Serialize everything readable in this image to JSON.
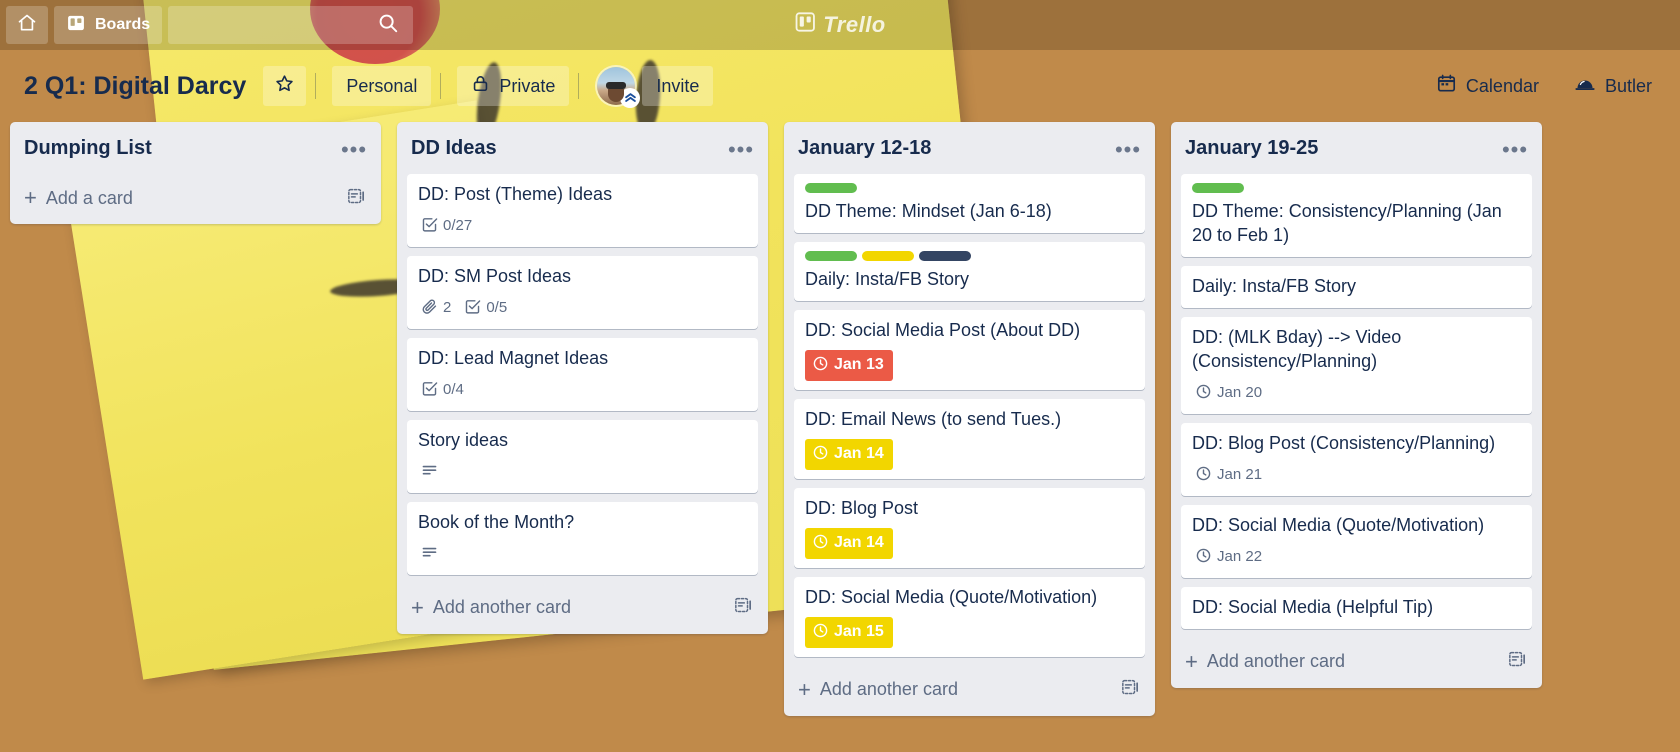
{
  "top_nav": {
    "home_icon": "home-icon",
    "boards_label": "Boards",
    "boards_icon": "board-icon",
    "search_placeholder": "",
    "search_value": "",
    "search_icon": "search-icon",
    "logo_text": "Trello",
    "logo_icon": "trello-logo-icon"
  },
  "board_header": {
    "title": "2 Q1: Digital Darcy",
    "star_icon": "star-icon",
    "visibility_team": "Personal",
    "visibility": "Private",
    "lock_icon": "lock-icon",
    "avatar_name": "avatar",
    "avatar_badge_icon": "premium-chevrons-icon",
    "invite_label": "Invite",
    "calendar_label": "Calendar",
    "calendar_icon": "calendar-icon",
    "butler_label": "Butler",
    "butler_icon": "butler-bell-icon"
  },
  "colors": {
    "label_green": "#61bd4f",
    "label_yellow": "#f2d600",
    "label_navy": "#344563",
    "due_overdue": "#eb5a46",
    "due_soon": "#f2d600",
    "list_bg": "#ebecf0",
    "card_bg": "#ffffff",
    "text": "#172b4d",
    "muted_text": "#5e6c84"
  },
  "add_card_label": "Add a card",
  "add_another_card_label": "Add another card",
  "lists": [
    {
      "title": "Dumping List",
      "menu_icon": "list-menu-icon",
      "add_label": "Add a card",
      "template_icon": "card-template-icon",
      "cards": []
    },
    {
      "title": "DD Ideas",
      "menu_icon": "list-menu-icon",
      "add_label": "Add another card",
      "template_icon": "card-template-icon",
      "cards": [
        {
          "title": "DD: Post (Theme) Ideas",
          "labels": [],
          "badges": [
            {
              "type": "checklist",
              "icon": "checklist-icon",
              "text": "0/27"
            }
          ]
        },
        {
          "title": "DD: SM Post Ideas",
          "labels": [],
          "badges": [
            {
              "type": "attachment",
              "icon": "attachment-icon",
              "text": "2"
            },
            {
              "type": "checklist",
              "icon": "checklist-icon",
              "text": "0/5"
            }
          ]
        },
        {
          "title": "DD: Lead Magnet Ideas",
          "labels": [],
          "badges": [
            {
              "type": "checklist",
              "icon": "checklist-icon",
              "text": "0/4"
            }
          ]
        },
        {
          "title": "Story ideas",
          "labels": [],
          "badges": [
            {
              "type": "description",
              "icon": "description-icon",
              "text": ""
            }
          ]
        },
        {
          "title": "Book of the Month?",
          "labels": [],
          "badges": [
            {
              "type": "description",
              "icon": "description-icon",
              "text": ""
            }
          ]
        }
      ]
    },
    {
      "title": "January 12-18",
      "menu_icon": "list-menu-icon",
      "add_label": "Add another card",
      "template_icon": "card-template-icon",
      "cards": [
        {
          "title": "DD Theme: Mindset (Jan 6-18)",
          "labels": [
            "#61bd4f"
          ],
          "badges": []
        },
        {
          "title": "Daily: Insta/FB Story",
          "labels": [
            "#61bd4f",
            "#f2d600",
            "#344563"
          ],
          "badges": []
        },
        {
          "title": "DD: Social Media Post (About DD)",
          "labels": [],
          "badges": [
            {
              "type": "due-red",
              "icon": "clock-icon",
              "text": "Jan 13"
            }
          ]
        },
        {
          "title": "DD: Email News (to send Tues.)",
          "labels": [],
          "badges": [
            {
              "type": "due-yellow",
              "icon": "clock-icon",
              "text": "Jan 14"
            }
          ]
        },
        {
          "title": "DD: Blog Post",
          "labels": [],
          "badges": [
            {
              "type": "due-yellow",
              "icon": "clock-icon",
              "text": "Jan 14"
            }
          ]
        },
        {
          "title": "DD: Social Media (Quote/Motivation)",
          "labels": [],
          "badges": [
            {
              "type": "due-yellow",
              "icon": "clock-icon",
              "text": "Jan 15"
            }
          ]
        }
      ]
    },
    {
      "title": "January 19-25",
      "menu_icon": "list-menu-icon",
      "add_label": "Add another card",
      "template_icon": "card-template-icon",
      "cards": [
        {
          "title": "DD Theme: Consistency/Planning (Jan 20 to Feb 1)",
          "labels": [
            "#61bd4f"
          ],
          "badges": []
        },
        {
          "title": "Daily: Insta/FB Story",
          "labels": [],
          "badges": []
        },
        {
          "title": "DD: (MLK Bday) --> Video (Consistency/Planning)",
          "labels": [],
          "badges": [
            {
              "type": "due-plain",
              "icon": "clock-icon",
              "text": "Jan 20"
            }
          ]
        },
        {
          "title": "DD: Blog Post (Consistency/Planning)",
          "labels": [],
          "badges": [
            {
              "type": "due-plain",
              "icon": "clock-icon",
              "text": "Jan 21"
            }
          ]
        },
        {
          "title": "DD: Social Media (Quote/Motivation)",
          "labels": [],
          "badges": [
            {
              "type": "due-plain",
              "icon": "clock-icon",
              "text": "Jan 22"
            }
          ]
        },
        {
          "title": "DD: Social Media (Helpful Tip)",
          "labels": [],
          "badges": []
        }
      ]
    }
  ]
}
